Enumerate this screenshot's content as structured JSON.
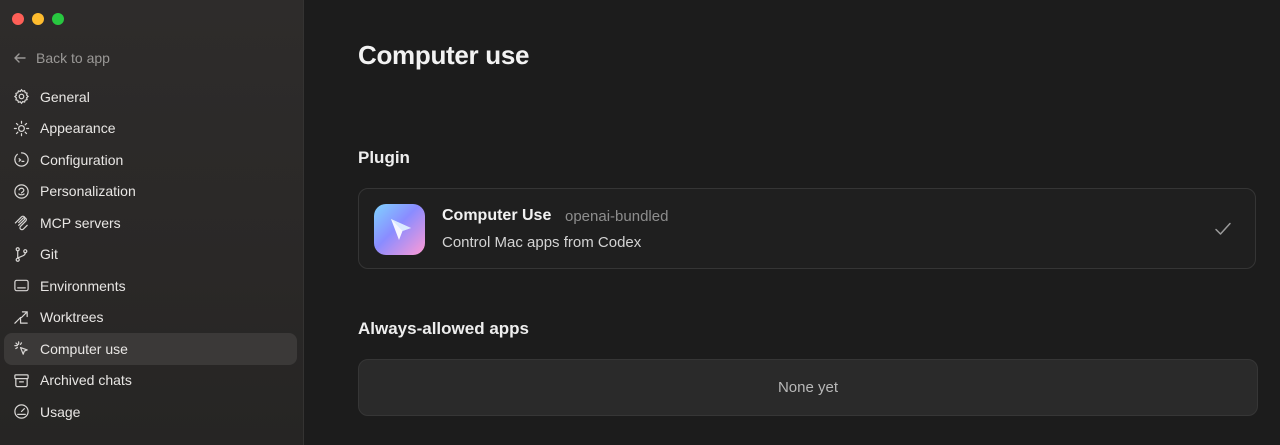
{
  "window": {
    "controls": [
      "close",
      "minimize",
      "zoom"
    ]
  },
  "sidebar": {
    "back_label": "Back to app",
    "items": [
      {
        "label": "General",
        "icon": "gear-icon"
      },
      {
        "label": "Appearance",
        "icon": "sun-icon"
      },
      {
        "label": "Configuration",
        "icon": "config-icon"
      },
      {
        "label": "Personalization",
        "icon": "personalization-icon"
      },
      {
        "label": "MCP servers",
        "icon": "mcp-icon"
      },
      {
        "label": "Git",
        "icon": "git-branch-icon"
      },
      {
        "label": "Environments",
        "icon": "monitor-icon"
      },
      {
        "label": "Worktrees",
        "icon": "worktree-icon"
      },
      {
        "label": "Computer use",
        "icon": "cursor-click-icon",
        "active": true
      },
      {
        "label": "Archived chats",
        "icon": "archive-icon"
      },
      {
        "label": "Usage",
        "icon": "gauge-icon"
      }
    ]
  },
  "main": {
    "title": "Computer use",
    "plugin_section": {
      "title": "Plugin",
      "plugin": {
        "name": "Computer Use",
        "source": "openai-bundled",
        "description": "Control Mac apps from Codex",
        "enabled": true
      }
    },
    "allowed_section": {
      "title": "Always-allowed apps",
      "empty_text": "None yet"
    }
  },
  "colors": {
    "sidebar_bg": "#2b2928",
    "main_bg": "#1c1c1c",
    "active_item_bg": "#3b3938"
  }
}
